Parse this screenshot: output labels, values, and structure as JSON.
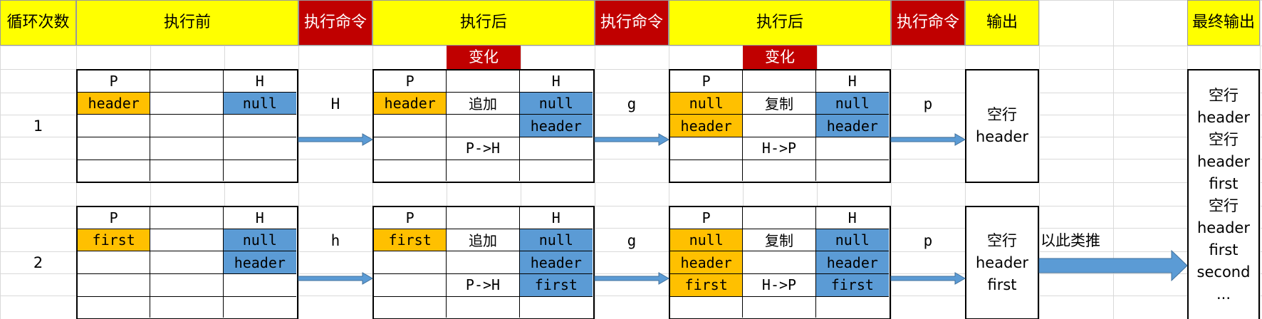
{
  "header": {
    "loop_count": "循环次数",
    "before": "执行前",
    "command_a": "执行命令",
    "after_a": "执行后",
    "command_b": "执行命令",
    "after_b": "执行后",
    "command_c": "执行命令",
    "output": "输出",
    "final_output": "最终输出",
    "change_a": "变化",
    "change_b": "变化"
  },
  "colors": {
    "yellow": "#ffff00",
    "red": "#c00000",
    "orange": "#ffc000",
    "blue": "#5b9bd5",
    "arrow": "#5b9bd5"
  },
  "rows": [
    {
      "loop": "1",
      "before": {
        "p_head": "P",
        "h_head": "H",
        "p": [
          "header",
          "",
          "",
          ""
        ],
        "h": [
          "null",
          "",
          "",
          ""
        ]
      },
      "cmd1": "H",
      "after1": {
        "p_head": "P",
        "h_head": "H",
        "p": [
          "header",
          "",
          "",
          ""
        ],
        "mid": [
          "追加",
          "",
          "P->H",
          ""
        ],
        "h": [
          "null",
          "header",
          "",
          ""
        ]
      },
      "cmd2": "g",
      "after2": {
        "p_head": "P",
        "h_head": "H",
        "p": [
          "null",
          "header",
          "",
          ""
        ],
        "mid": [
          "复制",
          "",
          "H->P",
          ""
        ],
        "h": [
          "null",
          "header",
          "",
          ""
        ]
      },
      "cmd3": "p",
      "output": [
        "空行",
        "header"
      ]
    },
    {
      "loop": "2",
      "before": {
        "p_head": "P",
        "h_head": "H",
        "p": [
          "first",
          "",
          "",
          ""
        ],
        "h": [
          "null",
          "header",
          "",
          ""
        ]
      },
      "cmd1": "h",
      "after1": {
        "p_head": "P",
        "h_head": "H",
        "p": [
          "first",
          "",
          "",
          ""
        ],
        "mid": [
          "追加",
          "",
          "P->H",
          ""
        ],
        "h": [
          "null",
          "header",
          "first",
          ""
        ]
      },
      "cmd2": "g",
      "after2": {
        "p_head": "P",
        "h_head": "H",
        "p": [
          "null",
          "header",
          "first",
          ""
        ],
        "mid": [
          "复制",
          "",
          "H->P",
          ""
        ],
        "h": [
          "null",
          "header",
          "first",
          ""
        ]
      },
      "cmd3": "p",
      "output": [
        "空行",
        "header",
        "first"
      ]
    }
  ],
  "and_so_on": "以此类推",
  "final_output": [
    "空行",
    "header",
    "空行",
    "header",
    "first",
    "空行",
    "header",
    "first",
    "second",
    "..."
  ]
}
